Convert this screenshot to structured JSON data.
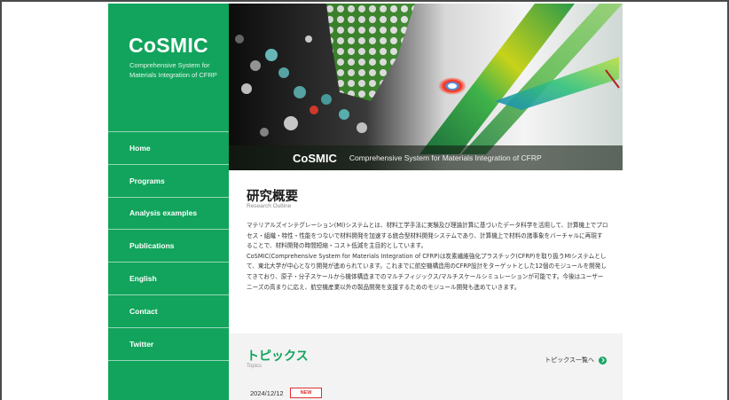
{
  "brand": {
    "logo": "CoSMIC",
    "subtitle": "Comprehensive System for Materials Integration of CFRP",
    "color": "#12a45c"
  },
  "nav": {
    "items": [
      {
        "label": "Home"
      },
      {
        "label": "Programs"
      },
      {
        "label": "Analysis examples"
      },
      {
        "label": "Publications"
      },
      {
        "label": "English"
      },
      {
        "label": "Contact"
      },
      {
        "label": "Twitter"
      }
    ]
  },
  "hero": {
    "logo": "CoSMIC",
    "tagline": "Comprehensive System for Materials Integration of CFRP"
  },
  "research": {
    "title": "研究概要",
    "subtitle": "Research Outline",
    "paragraphs": [
      "マテリアルズインテグレーション(MI)システムとは、材料工学手法に実験及び理論計算に基づいたデータ科学を活用して、計算機上でプロセス・組織・特性・性能をつないで材料開発を加速する統合型材料開発システムであり、計算機上で材料の諸事象をバーチャルに再現することで、材料開発の時間短縮・コスト低減を主目的としています。",
      "CoSMIC(Comprehensive System for Materials Integration of CFRP)は炭素繊維強化プラスチック(CFRP)を取り扱うMIシステムとして、東北大学が中心となり開発が進められています。これまでに航空機構造用のCFRP設計をターゲットとした12個のモジュールを開発してきており、原子・分子スケールから機体構造までのマルチフィジックス/マルチスケールシミュレーションが可能です。今後はユーザーニーズの高まりに応え、航空機産業以外の製品開発を支援するためのモジュール開発も進めていきます。"
    ]
  },
  "topics": {
    "title": "トピックス",
    "subtitle": "Topics",
    "link_label": "トピックス一覧へ",
    "items": [
      {
        "date": "2024/12/12",
        "badge": "NEW"
      }
    ]
  }
}
